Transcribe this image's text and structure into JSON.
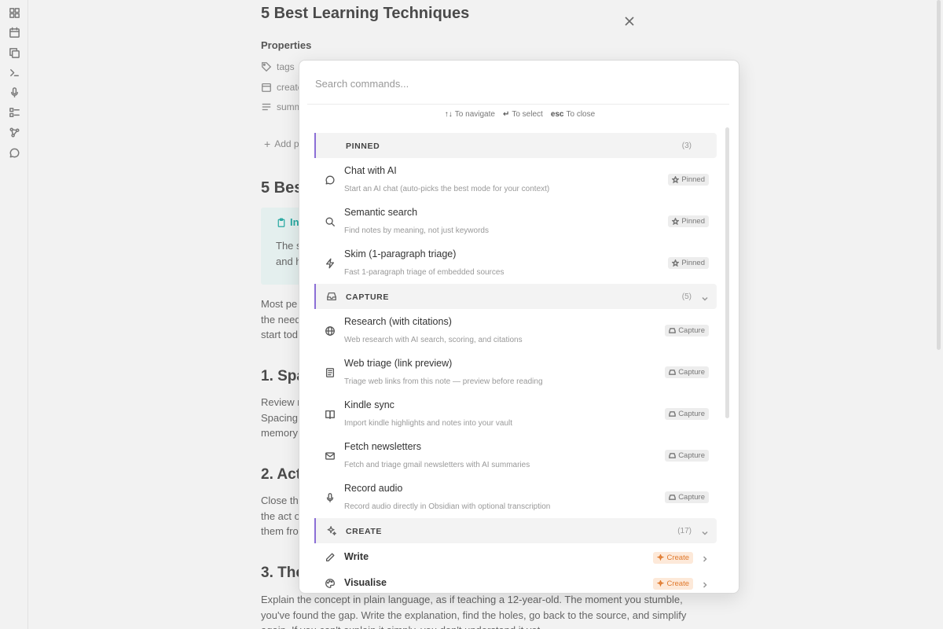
{
  "note": {
    "title": "5 Best Learning Techniques",
    "properties_label": "Properties",
    "properties": [
      {
        "icon": "tag-icon",
        "label": "tags"
      },
      {
        "icon": "calendar-icon",
        "label": "create"
      },
      {
        "icon": "list-icon",
        "label": "summ"
      }
    ],
    "add_property": "Add p",
    "heading_partial": "5 Bes",
    "callout_title": "In",
    "callout_lines": [
      "The s",
      "and h"
    ],
    "para1": [
      "Most pe",
      "the need",
      "start tod"
    ],
    "h2_1": "1. Spa",
    "para2": [
      "Review n",
      "Spacing",
      "memory"
    ],
    "h2_2": "2. Act",
    "para3": [
      "Close the",
      "the act o",
      "them fro"
    ],
    "h2_3": "3. The",
    "para4": [
      "Explain the concept in plain language, as if teaching a 12-year-old. The moment you stumble,",
      "you've found the gap. Write the explanation, find the holes, go back to the source, and simplify",
      "again. If you can't explain it simply, you don't understand it yet."
    ]
  },
  "palette": {
    "search_placeholder": "Search commands...",
    "hints": [
      {
        "key": "↑↓",
        "text": "To navigate"
      },
      {
        "key": "↵",
        "text": "To select"
      },
      {
        "key": "esc",
        "text": "To close"
      }
    ],
    "sections": {
      "pinned": {
        "label": "PINNED",
        "count": "(3)"
      },
      "capture": {
        "label": "CAPTURE",
        "count": "(5)"
      },
      "create": {
        "label": "CREATE",
        "count": "(17)"
      }
    },
    "pinned_items": [
      {
        "title": "Chat with AI",
        "desc": "Start an AI chat (auto-picks the best mode for your context)",
        "badge": "Pinned",
        "icon": "chat-icon"
      },
      {
        "title": "Semantic search",
        "desc": "Find notes by meaning, not just keywords",
        "badge": "Pinned",
        "icon": "search-icon"
      },
      {
        "title": "Skim (1-paragraph triage)",
        "desc": "Fast 1-paragraph triage of embedded sources",
        "badge": "Pinned",
        "icon": "lightning-icon"
      }
    ],
    "capture_items": [
      {
        "title": "Research (with citations)",
        "desc": "Web research with AI search, scoring, and citations",
        "badge": "Capture",
        "icon": "globe-icon"
      },
      {
        "title": "Web triage (link preview)",
        "desc": "Triage web links from this note — preview before reading",
        "badge": "Capture",
        "icon": "newspaper-icon"
      },
      {
        "title": "Kindle sync",
        "desc": "Import kindle highlights and notes into your vault",
        "badge": "Capture",
        "icon": "book-icon"
      },
      {
        "title": "Fetch newsletters",
        "desc": "Fetch and triage gmail newsletters with AI summaries",
        "badge": "Capture",
        "icon": "mail-icon"
      },
      {
        "title": "Record audio",
        "desc": "Record audio directly in Obsidian with optional transcription",
        "badge": "Capture",
        "icon": "mic-icon"
      }
    ],
    "create_items": [
      {
        "title": "Write",
        "badge": "Create",
        "icon": "pen-icon"
      },
      {
        "title": "Visualise",
        "badge": "Create",
        "icon": "palette-icon"
      }
    ]
  }
}
